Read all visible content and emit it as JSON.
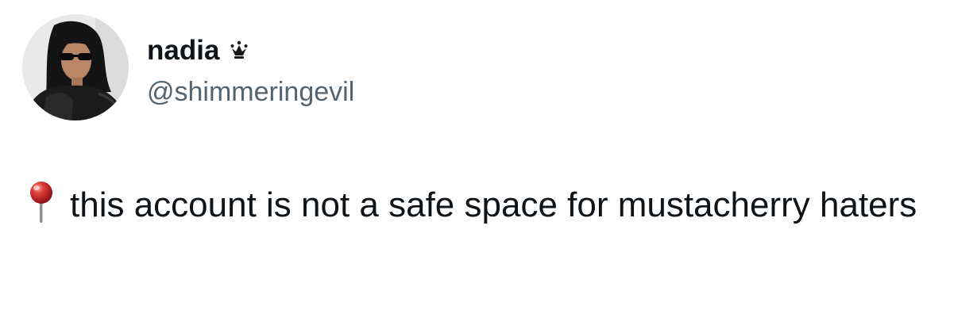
{
  "tweet": {
    "author": {
      "display_name": "nadia",
      "badge_icon": "crown-icon",
      "handle": "@shimmeringevil"
    },
    "body": {
      "leading_icon": "round-pushpin-icon",
      "text": "this account is not a safe space for mustacherry haters"
    }
  },
  "colors": {
    "text_primary": "#0f1419",
    "text_secondary": "#536471",
    "pin_red": "#d2262d",
    "background": "#ffffff"
  }
}
